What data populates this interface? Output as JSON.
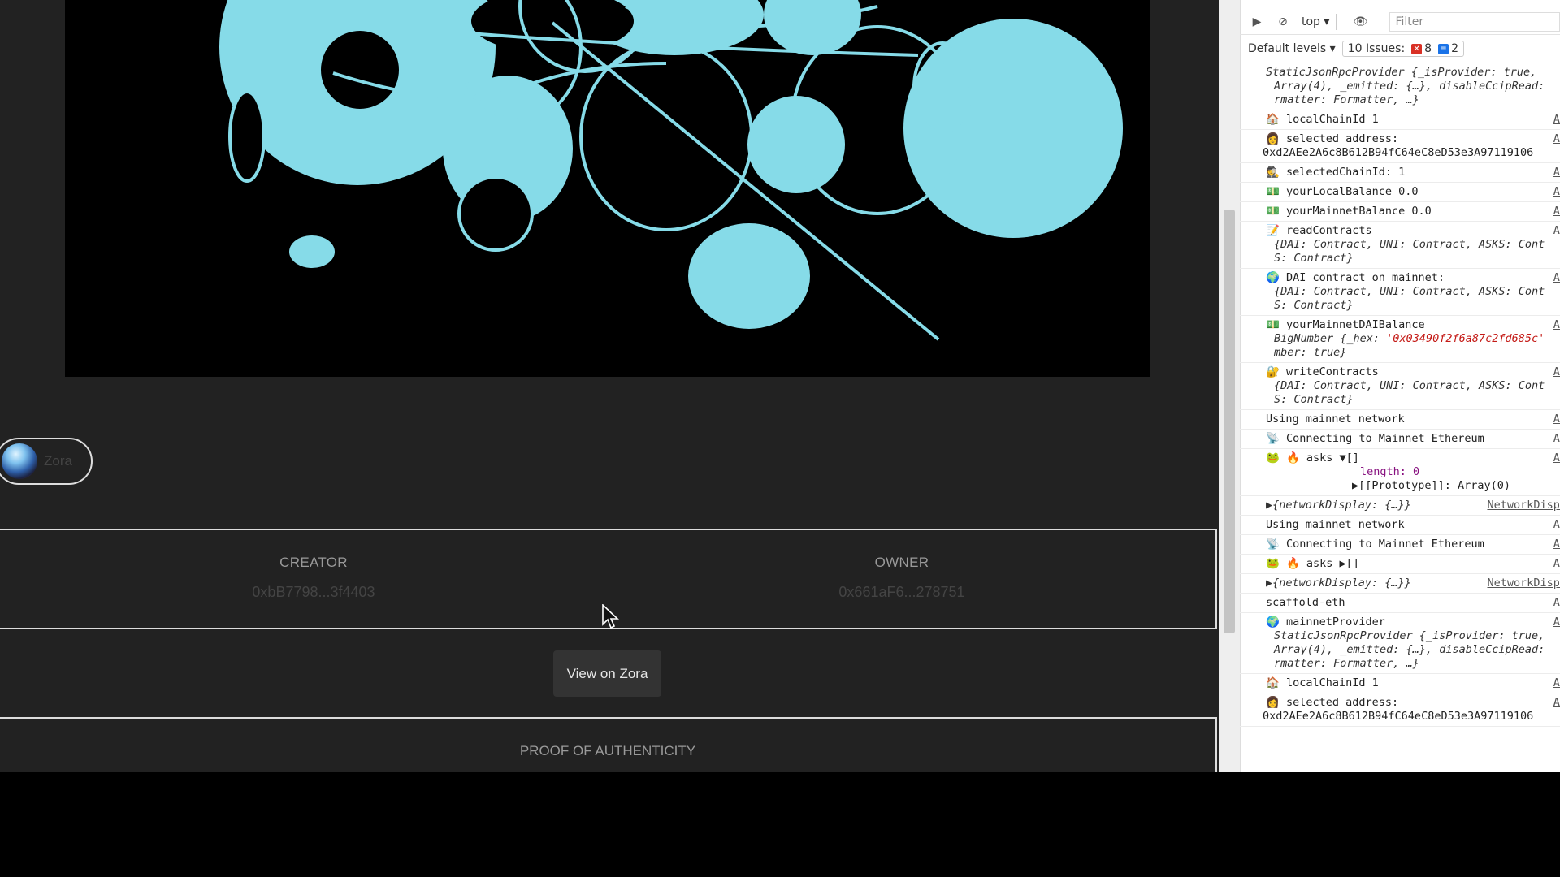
{
  "artwork": {
    "fill_color": "#86dbe8",
    "background": "#000000"
  },
  "chip": {
    "label": "Zora"
  },
  "meta": {
    "creator_label": "CREATOR",
    "creator_value": "0xbB7798...3f4403",
    "owner_label": "OWNER",
    "owner_value": "0x661aF6...278751"
  },
  "actions": {
    "view_label": "View on Zora"
  },
  "proof": {
    "title": "PROOF OF AUTHENTICITY"
  },
  "devtools": {
    "context": "top",
    "filter_placeholder": "Filter",
    "default_levels": "Default levels",
    "issues_label": "10 Issues:",
    "issues_errors": "8",
    "issues_info": "2",
    "log": [
      {
        "id": "r0",
        "kind": "obj",
        "l1": "StaticJsonRpcProvider {_isProvider: true,",
        "l2": "Array(4), _emitted: {…}, disableCcipRead:",
        "l3": "rmatter: Formatter, …}"
      },
      {
        "id": "r1",
        "emoji": "🏠",
        "text": "localChainId 1",
        "src": "Ap"
      },
      {
        "id": "r2",
        "emoji": "👩",
        "text": "selected address:",
        "l2": "0xd2AEe2A6c8B612B94fC64eC8eD53e3A97119106",
        "src": "Ap"
      },
      {
        "id": "r3",
        "emoji": "🕵",
        "text": "selectedChainId: 1",
        "src": "Ap"
      },
      {
        "id": "r4",
        "emoji": "💵",
        "text": "yourLocalBalance 0.0",
        "src": "Ap"
      },
      {
        "id": "r5",
        "emoji": "💵",
        "text": "yourMainnetBalance 0.0",
        "src": "Ap"
      },
      {
        "id": "r6",
        "emoji": "📝",
        "text": "readContracts",
        "l2": "{DAI: Contract, UNI: Contract, ASKS: Cont",
        "l3": "S: Contract}",
        "src": "Ap"
      },
      {
        "id": "r7",
        "emoji": "🌍",
        "text": "DAI contract on mainnet:",
        "l2": "{DAI: Contract, UNI: Contract, ASKS: Cont",
        "l3": "S: Contract}",
        "src": "Ap"
      },
      {
        "id": "r8",
        "emoji": "💵",
        "text": "yourMainnetDAIBalance",
        "l2a": "BigNumber {_hex: ",
        "l2b": "'0x03490f2f6a87c2fd685c'",
        "l3": "mber: true}",
        "src": "Ap"
      },
      {
        "id": "r9",
        "emoji": "🔐",
        "text": "writeContracts",
        "l2": "{DAI: Contract, UNI: Contract, ASKS: Cont",
        "l3": "S: Contract}",
        "src": "Ap"
      },
      {
        "id": "r10",
        "text": "Using mainnet network",
        "src": "Ap"
      },
      {
        "id": "r11",
        "emoji": "📡",
        "text": "Connecting to Mainnet Ethereum",
        "src": "Ap"
      },
      {
        "id": "r12",
        "emoji": "🐸",
        "emoji2": "🔥",
        "text": "asks ▼[]",
        "len": "length: 0",
        "proto": "[[Prototype]]: Array(0)",
        "src": "Ap"
      },
      {
        "id": "r13",
        "text": "{networkDisplay: {…}}",
        "src": "NetworkDispl"
      },
      {
        "id": "r14",
        "text": "Using mainnet network",
        "src": "Ap"
      },
      {
        "id": "r15",
        "emoji": "📡",
        "text": "Connecting to Mainnet Ethereum",
        "src": "Ap"
      },
      {
        "id": "r16",
        "emoji": "🐸",
        "emoji2": "🔥",
        "text": "asks ▶[]",
        "src": "Ap"
      },
      {
        "id": "r17",
        "text": "{networkDisplay: {…}}",
        "src": "NetworkDispl"
      },
      {
        "id": "r18",
        "text": "scaffold-eth",
        "src": "Ap"
      },
      {
        "id": "r19",
        "emoji": "🌍",
        "text": "mainnetProvider",
        "l2": "StaticJsonRpcProvider {_isProvider: true,",
        "l3": "Array(4), _emitted: {…}, disableCcipRead:",
        "l4": "rmatter: Formatter, …}",
        "src": "Ap"
      },
      {
        "id": "r20",
        "emoji": "🏠",
        "text": "localChainId 1",
        "src": "Ap"
      },
      {
        "id": "r21",
        "emoji": "👩",
        "text": "selected address:",
        "l2": "0xd2AEe2A6c8B612B94fC64eC8eD53e3A97119106",
        "src": "Ap"
      }
    ]
  }
}
